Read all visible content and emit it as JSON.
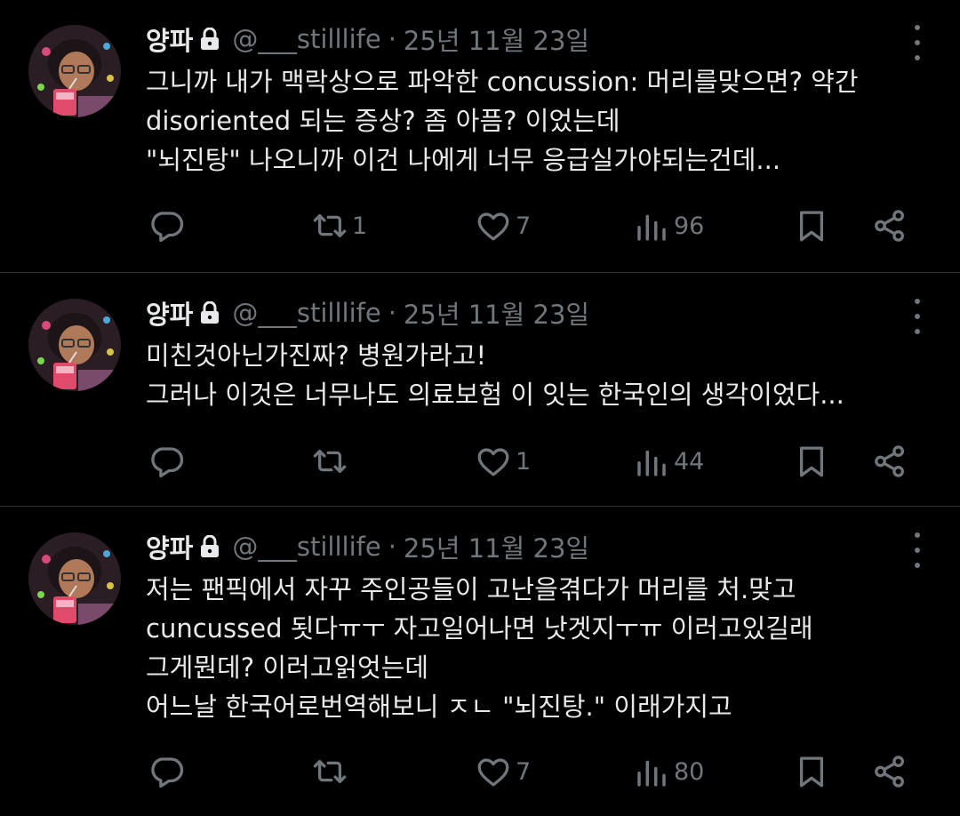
{
  "tweets": [
    {
      "author": {
        "name": "양파",
        "handle": "@___stilllife",
        "date": "25년 11월 23일",
        "locked": true
      },
      "text_lines": [
        "그니까 내가 맥락상으로 파악한 concussion: 머리를맞으면? 약간",
        "disoriented 되는 증상? 좀 아픔? 이었는데",
        "\"뇌진탕\" 나오니까 이건 나에게 너무 응급실가야되는건데..."
      ],
      "stats": {
        "replies": "",
        "retweets": "1",
        "likes": "7",
        "views": "96"
      }
    },
    {
      "author": {
        "name": "양파",
        "handle": "@___stilllife",
        "date": "25년 11월 23일",
        "locked": true
      },
      "text_lines": [
        "미친것아닌가진짜? 병원가라고!",
        "그러나 이것은 너무나도 의료보험 이 잇는 한국인의 생각이었다..."
      ],
      "stats": {
        "replies": "",
        "retweets": "",
        "likes": "1",
        "views": "44"
      }
    },
    {
      "author": {
        "name": "양파",
        "handle": "@___stilllife",
        "date": "25년 11월 23일",
        "locked": true
      },
      "text_lines": [
        "저는 팬픽에서 자꾸 주인공들이 고난을겪다가 머리를 처.맞고",
        "cuncussed 됫다ㅠㅜ 자고일어나면 낫겟지ㅜㅠ 이러고있길래",
        "그게뭔데? 이러고읽엇는데",
        "어느날 한국어로번역해보니 ㅈㄴ \"뇌진탕.\" 이래가지고"
      ],
      "stats": {
        "replies": "",
        "retweets": "",
        "likes": "7",
        "views": "80"
      }
    }
  ],
  "separator": "·",
  "icons": {
    "lock": "lock-icon",
    "more": "more-icon",
    "reply": "reply-icon",
    "retweet": "retweet-icon",
    "like": "heart-icon",
    "views": "views-icon",
    "bookmark": "bookmark-icon",
    "share": "share-icon"
  },
  "colors": {
    "background": "#000000",
    "text": "#e7e9ea",
    "secondary": "#71767b",
    "divider": "#2f3336"
  }
}
